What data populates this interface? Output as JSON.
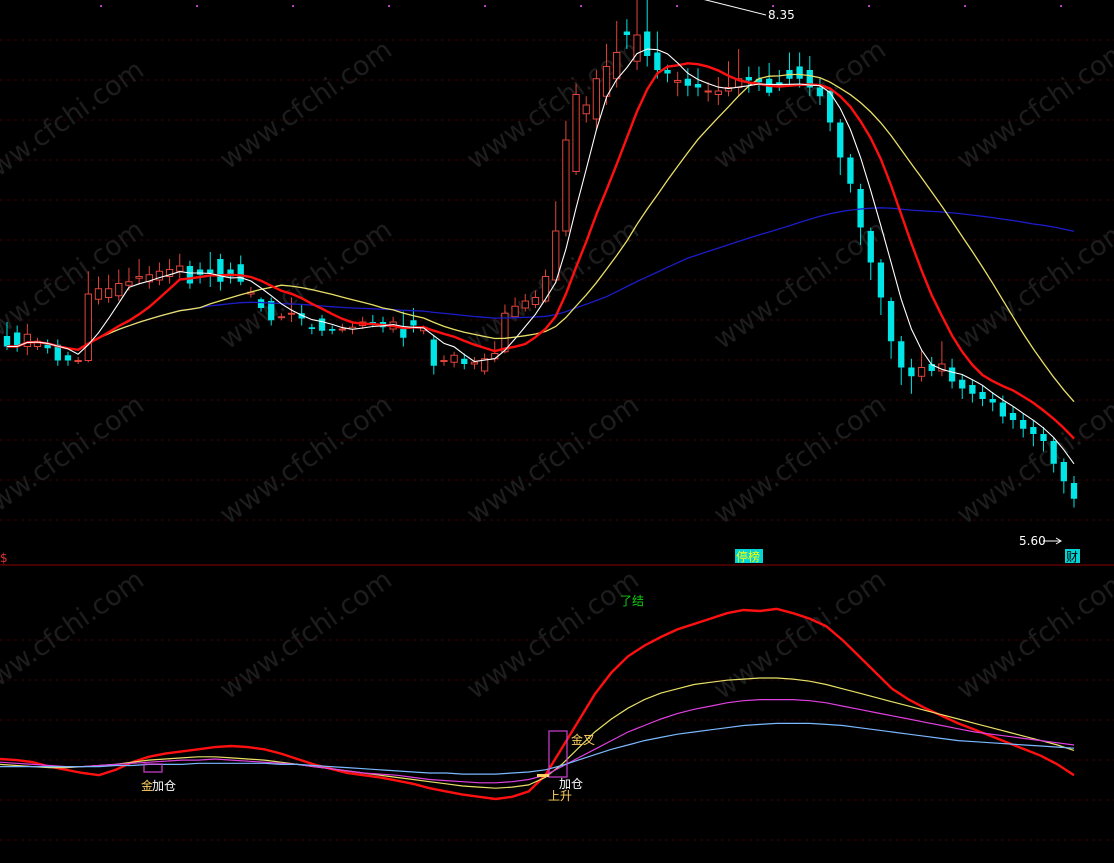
{
  "colors": {
    "background": "#000000",
    "grid": "#3a0000",
    "separator": "#8c0000",
    "up": "#e0443a",
    "down": "#00e5e5",
    "ma_fast": "#ffffff",
    "ma_mid": "#ff1010",
    "ma_slow": "#e8e066",
    "ma_long": "#1c1cc8",
    "osc_red": "#ff1010",
    "osc_yellow": "#e8e066",
    "osc_magenta": "#e040e0",
    "osc_blue": "#7ab8ff",
    "tag_bg": "#00d4d4",
    "watermark": "#1d1d1d"
  },
  "watermark": "www.cfchi.com",
  "marks": {
    "high": "8.35",
    "low": "5.60",
    "limit_tag": "停榜",
    "finance_tag": "财",
    "left_tag": "$"
  },
  "chart_data": [
    {
      "type": "candlestick",
      "ylim": [
        5.3,
        8.5
      ],
      "highest": 8.35,
      "lowest": 5.6,
      "candles": [
        [
          6.58,
          6.52,
          6.66,
          6.5
        ],
        [
          6.6,
          6.52,
          6.64,
          6.49
        ],
        [
          6.52,
          6.59,
          6.65,
          6.47
        ],
        [
          6.52,
          6.55,
          6.57,
          6.5
        ],
        [
          6.53,
          6.51,
          6.56,
          6.48
        ],
        [
          6.53,
          6.44,
          6.56,
          6.41
        ],
        [
          6.47,
          6.44,
          6.49,
          6.41
        ],
        [
          6.44,
          6.44,
          6.46,
          6.42
        ],
        [
          6.44,
          6.82,
          6.95,
          6.43
        ],
        [
          6.79,
          6.85,
          6.92,
          6.76
        ],
        [
          6.8,
          6.85,
          6.93,
          6.77
        ],
        [
          6.81,
          6.88,
          6.96,
          6.78
        ],
        [
          6.87,
          6.89,
          6.97,
          6.84
        ],
        [
          6.91,
          6.92,
          7.02,
          6.88
        ],
        [
          6.89,
          6.93,
          6.98,
          6.85
        ],
        [
          6.9,
          6.95,
          7.0,
          6.87
        ],
        [
          6.92,
          6.96,
          7.02,
          6.88
        ],
        [
          6.95,
          6.98,
          7.05,
          6.91
        ],
        [
          6.98,
          6.88,
          7.01,
          6.85
        ],
        [
          6.96,
          6.93,
          7.0,
          6.88
        ],
        [
          6.96,
          6.94,
          7.06,
          6.86
        ],
        [
          7.02,
          6.89,
          7.05,
          6.84
        ],
        [
          6.96,
          6.92,
          7.0,
          6.88
        ],
        [
          6.99,
          6.89,
          7.04,
          6.87
        ],
        [
          6.82,
          6.83,
          6.86,
          6.8
        ],
        [
          6.79,
          6.74,
          6.8,
          6.72
        ],
        [
          6.78,
          6.67,
          6.8,
          6.64
        ],
        [
          6.69,
          6.69,
          6.71,
          6.67
        ],
        [
          6.71,
          6.71,
          6.8,
          6.66
        ],
        [
          6.71,
          6.68,
          6.76,
          6.64
        ],
        [
          6.63,
          6.62,
          6.65,
          6.59
        ],
        [
          6.68,
          6.61,
          6.7,
          6.58
        ],
        [
          6.62,
          6.61,
          6.64,
          6.59
        ],
        [
          6.62,
          6.62,
          6.65,
          6.6
        ],
        [
          6.62,
          6.63,
          6.66,
          6.59
        ],
        [
          6.64,
          6.66,
          6.69,
          6.62
        ],
        [
          6.66,
          6.65,
          6.7,
          6.63
        ],
        [
          6.66,
          6.63,
          6.69,
          6.6
        ],
        [
          6.62,
          6.66,
          6.69,
          6.6
        ],
        [
          6.62,
          6.57,
          6.72,
          6.52
        ],
        [
          6.67,
          6.64,
          6.74,
          6.6
        ],
        [
          6.61,
          6.63,
          6.64,
          6.59
        ],
        [
          6.56,
          6.41,
          6.58,
          6.36
        ],
        [
          6.44,
          6.44,
          6.47,
          6.41
        ],
        [
          6.43,
          6.47,
          6.49,
          6.4
        ],
        [
          6.45,
          6.42,
          6.48,
          6.39
        ],
        [
          6.42,
          6.43,
          6.46,
          6.39
        ],
        [
          6.38,
          6.45,
          6.48,
          6.36
        ],
        [
          6.45,
          6.48,
          6.55,
          6.43
        ],
        [
          6.49,
          6.71,
          6.76,
          6.48
        ],
        [
          6.69,
          6.75,
          6.8,
          6.68
        ],
        [
          6.74,
          6.78,
          6.82,
          6.72
        ],
        [
          6.76,
          6.8,
          6.84,
          6.74
        ],
        [
          6.78,
          6.92,
          6.96,
          6.77
        ],
        [
          6.9,
          7.18,
          7.35,
          6.88
        ],
        [
          7.18,
          7.7,
          7.81,
          7.15
        ],
        [
          7.52,
          7.96,
          8.02,
          7.5
        ],
        [
          7.85,
          7.9,
          7.95,
          7.8
        ],
        [
          7.82,
          8.05,
          8.1,
          7.76
        ],
        [
          7.95,
          8.12,
          8.25,
          7.9
        ],
        [
          8.05,
          8.2,
          8.38,
          8.0
        ],
        [
          8.32,
          8.3,
          8.39,
          8.22
        ],
        [
          8.15,
          8.3,
          8.6,
          8.1
        ],
        [
          8.32,
          8.18,
          8.6,
          8.12
        ],
        [
          8.2,
          8.1,
          8.32,
          8.05
        ],
        [
          8.1,
          8.08,
          8.13,
          8.03
        ],
        [
          8.03,
          8.04,
          8.09,
          7.95
        ],
        [
          8.05,
          8.01,
          8.11,
          7.95
        ],
        [
          8.02,
          8.0,
          8.11,
          7.95
        ],
        [
          7.98,
          7.98,
          8.03,
          7.92
        ],
        [
          7.96,
          7.98,
          8.06,
          7.9
        ],
        [
          7.98,
          8.0,
          8.15,
          7.95
        ],
        [
          8.0,
          8.05,
          8.22,
          7.95
        ],
        [
          8.06,
          8.04,
          8.12,
          7.97
        ],
        [
          8.05,
          8.03,
          8.12,
          7.98
        ],
        [
          8.05,
          7.97,
          8.14,
          7.95
        ],
        [
          8.03,
          8.0,
          8.1,
          7.98
        ],
        [
          8.1,
          8.05,
          8.2,
          8.02
        ],
        [
          8.12,
          8.05,
          8.2,
          8.0
        ],
        [
          8.1,
          8.0,
          8.18,
          7.95
        ],
        [
          8.0,
          7.95,
          8.05,
          7.9
        ],
        [
          7.98,
          7.8,
          8.0,
          7.75
        ],
        [
          7.8,
          7.6,
          7.82,
          7.5
        ],
        [
          7.6,
          7.45,
          7.62,
          7.4
        ],
        [
          7.42,
          7.2,
          7.45,
          7.1
        ],
        [
          7.18,
          7.0,
          7.2,
          6.9
        ],
        [
          7.0,
          6.8,
          7.02,
          6.7
        ],
        [
          6.78,
          6.55,
          6.8,
          6.45
        ],
        [
          6.55,
          6.4,
          6.58,
          6.3
        ],
        [
          6.4,
          6.35,
          6.45,
          6.25
        ],
        [
          6.35,
          6.4,
          6.5,
          6.32
        ],
        [
          6.42,
          6.38,
          6.46,
          6.35
        ],
        [
          6.38,
          6.42,
          6.55,
          6.35
        ],
        [
          6.4,
          6.32,
          6.45,
          6.28
        ],
        [
          6.33,
          6.28,
          6.36,
          6.22
        ],
        [
          6.3,
          6.25,
          6.33,
          6.2
        ],
        [
          6.26,
          6.22,
          6.3,
          6.18
        ],
        [
          6.22,
          6.2,
          6.26,
          6.15
        ],
        [
          6.2,
          6.12,
          6.24,
          6.08
        ],
        [
          6.14,
          6.1,
          6.18,
          6.05
        ],
        [
          6.1,
          6.05,
          6.14,
          6.0
        ],
        [
          6.06,
          6.02,
          6.1,
          5.95
        ],
        [
          6.02,
          5.98,
          6.06,
          5.92
        ],
        [
          5.98,
          5.85,
          6.0,
          5.8
        ],
        [
          5.86,
          5.75,
          5.88,
          5.68
        ],
        [
          5.74,
          5.65,
          5.78,
          5.6
        ]
      ]
    },
    {
      "type": "line",
      "series": [
        {
          "values": [
            0.25,
            0.24,
            0.22,
            0.18,
            0.15,
            0.12,
            0.1,
            0.15,
            0.22,
            0.27,
            0.3,
            0.32,
            0.34,
            0.36,
            0.37,
            0.36,
            0.34,
            0.3,
            0.25,
            0.2,
            0.16,
            0.12,
            0.1,
            0.08,
            0.05,
            0.02,
            -0.02,
            -0.05,
            -0.08,
            -0.1,
            -0.12,
            -0.1,
            -0.05,
            0.1,
            0.35,
            0.6,
            0.85,
            1.05,
            1.2,
            1.3,
            1.38,
            1.45,
            1.5,
            1.55,
            1.6,
            1.63,
            1.62,
            1.64,
            1.6,
            1.55,
            1.48,
            1.35,
            1.2,
            1.05,
            0.9,
            0.8,
            0.72,
            0.65,
            0.58,
            0.52,
            0.46,
            0.4,
            0.34,
            0.28,
            0.2,
            0.1
          ]
        },
        {
          "values": [
            0.2,
            0.19,
            0.18,
            0.17,
            0.17,
            0.18,
            0.19,
            0.2,
            0.22,
            0.24,
            0.25,
            0.26,
            0.27,
            0.27,
            0.26,
            0.25,
            0.24,
            0.22,
            0.2,
            0.18,
            0.16,
            0.14,
            0.12,
            0.1,
            0.08,
            0.06,
            0.04,
            0.02,
            0.0,
            -0.01,
            -0.02,
            -0.01,
            0.01,
            0.08,
            0.2,
            0.35,
            0.5,
            0.62,
            0.72,
            0.8,
            0.86,
            0.9,
            0.94,
            0.96,
            0.98,
            0.99,
            1.0,
            1.0,
            0.99,
            0.97,
            0.94,
            0.9,
            0.86,
            0.82,
            0.78,
            0.74,
            0.7,
            0.66,
            0.62,
            0.58,
            0.54,
            0.5,
            0.46,
            0.42,
            0.38,
            0.33
          ]
        },
        {
          "values": [
            0.22,
            0.21,
            0.2,
            0.19,
            0.18,
            0.18,
            0.19,
            0.2,
            0.21,
            0.22,
            0.23,
            0.24,
            0.24,
            0.25,
            0.24,
            0.23,
            0.22,
            0.21,
            0.2,
            0.18,
            0.16,
            0.14,
            0.12,
            0.11,
            0.1,
            0.08,
            0.06,
            0.05,
            0.04,
            0.03,
            0.03,
            0.04,
            0.06,
            0.1,
            0.18,
            0.26,
            0.34,
            0.42,
            0.5,
            0.56,
            0.62,
            0.67,
            0.71,
            0.74,
            0.77,
            0.79,
            0.8,
            0.8,
            0.8,
            0.79,
            0.77,
            0.74,
            0.71,
            0.68,
            0.65,
            0.62,
            0.59,
            0.56,
            0.53,
            0.5,
            0.48,
            0.46,
            0.44,
            0.42,
            0.4,
            0.38
          ]
        },
        {
          "values": [
            0.18,
            0.18,
            0.18,
            0.18,
            0.18,
            0.18,
            0.18,
            0.19,
            0.19,
            0.2,
            0.2,
            0.2,
            0.21,
            0.21,
            0.21,
            0.21,
            0.21,
            0.2,
            0.2,
            0.19,
            0.18,
            0.17,
            0.16,
            0.15,
            0.14,
            0.13,
            0.12,
            0.12,
            0.11,
            0.11,
            0.11,
            0.12,
            0.13,
            0.15,
            0.19,
            0.24,
            0.29,
            0.34,
            0.38,
            0.42,
            0.45,
            0.48,
            0.5,
            0.52,
            0.54,
            0.56,
            0.57,
            0.58,
            0.58,
            0.58,
            0.57,
            0.56,
            0.54,
            0.52,
            0.5,
            0.48,
            0.46,
            0.44,
            0.42,
            0.41,
            0.4,
            0.39,
            0.38,
            0.37,
            0.36,
            0.35
          ]
        }
      ],
      "ylim": [
        -0.5,
        2.0
      ],
      "annotations": [
        "了结",
        "金叉",
        "加仓",
        "上升",
        "金",
        "加仓"
      ]
    }
  ]
}
